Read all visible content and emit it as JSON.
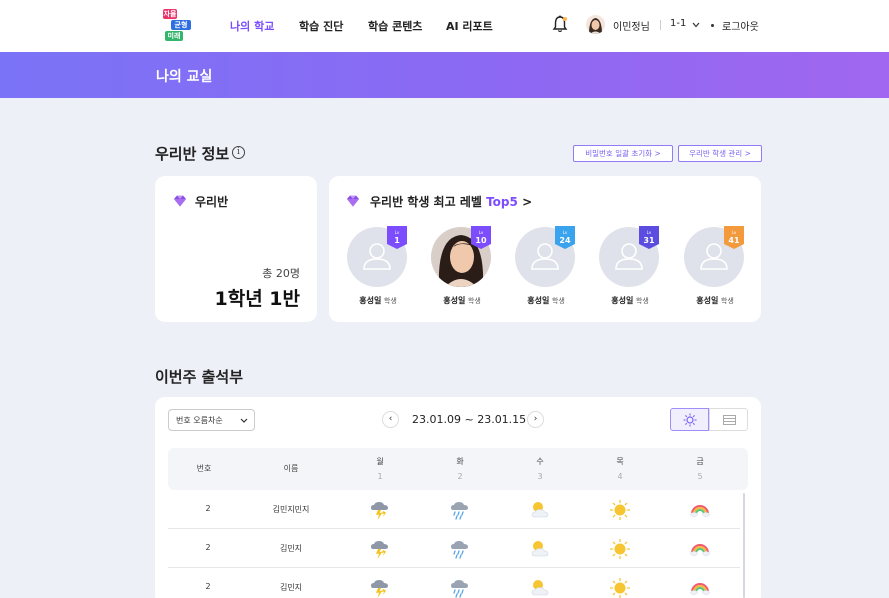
{
  "header": {
    "logo": {
      "line1": "자율",
      "line2": "균형",
      "line3": "미래"
    },
    "nav": [
      {
        "label": "나의 학교",
        "active": true
      },
      {
        "label": "학습 진단",
        "active": false
      },
      {
        "label": "학습 콘텐츠",
        "active": false
      },
      {
        "label": "AI 리포트",
        "active": false
      }
    ],
    "user_name": "이민정님",
    "class_selector": "1-1",
    "logout_label": "로그아웃"
  },
  "banner": {
    "title": "나의 교실"
  },
  "class_info": {
    "section_title": "우리반 정보",
    "reset_password_label": "비밀번호 일괄 초기화 >",
    "manage_students_label": "우리반 학생 관리 >",
    "my_class_card": {
      "label": "우리반",
      "total": "총 20명",
      "class_name": "1학년 1반"
    },
    "top5_card": {
      "label_prefix": "우리반 학생 최고 레벨",
      "label_accent": "Top5",
      "label_suffix": ">",
      "students": [
        {
          "name": "홍성일",
          "role": "학생",
          "lv_label": "Lv",
          "level": "1",
          "badge_color": "#7b4dff",
          "photo": false
        },
        {
          "name": "홍성일",
          "role": "학생",
          "lv_label": "Lv",
          "level": "10",
          "badge_color": "#7b4dff",
          "photo": true
        },
        {
          "name": "홍성일",
          "role": "학생",
          "lv_label": "Lv",
          "level": "24",
          "badge_color": "#3aa3ee",
          "photo": false
        },
        {
          "name": "홍성일",
          "role": "학생",
          "lv_label": "Lv",
          "level": "31",
          "badge_color": "#5a4de0",
          "photo": false
        },
        {
          "name": "홍성일",
          "role": "학생",
          "lv_label": "Lv",
          "level": "41",
          "badge_color": "#f39a3c",
          "photo": false
        }
      ]
    }
  },
  "attendance": {
    "section_title": "이번주 출석부",
    "sort_select": "번호 오름차순",
    "date_range": "23.01.09 ~ 23.01.15",
    "prev_label": "‹",
    "next_label": "›",
    "columns": {
      "number": "번호",
      "name": "이름"
    },
    "days": [
      {
        "day": "월",
        "date": "1"
      },
      {
        "day": "화",
        "date": "2"
      },
      {
        "day": "수",
        "date": "3"
      },
      {
        "day": "목",
        "date": "4"
      },
      {
        "day": "금",
        "date": "5"
      }
    ],
    "rows": [
      {
        "number": "2",
        "name": "김민지민지",
        "weather": [
          "thunder-icon",
          "rain-icon",
          "partly-cloudy-icon",
          "sun-icon",
          "rainbow-icon"
        ]
      },
      {
        "number": "2",
        "name": "김민지",
        "weather": [
          "thunder-icon",
          "rain-icon",
          "partly-cloudy-icon",
          "sun-icon",
          "rainbow-icon"
        ]
      },
      {
        "number": "2",
        "name": "김민지",
        "weather": [
          "thunder-icon",
          "rain-icon",
          "partly-cloudy-icon",
          "sun-icon",
          "rainbow-icon"
        ]
      }
    ]
  }
}
